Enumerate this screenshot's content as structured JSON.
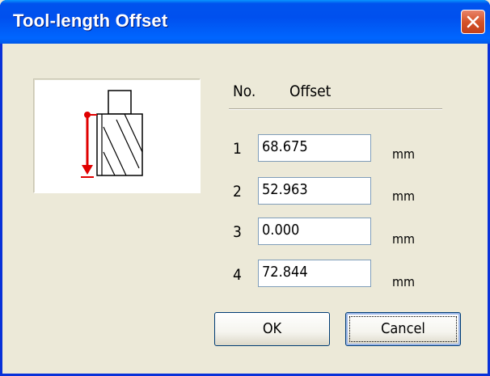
{
  "window": {
    "title": "Tool-length Offset"
  },
  "table": {
    "header_no": "No.",
    "header_offset": "Offset",
    "rows": [
      {
        "no": "1",
        "value": "68.675",
        "unit": "mm"
      },
      {
        "no": "2",
        "value": "52.963",
        "unit": "mm"
      },
      {
        "no": "3",
        "value": "0.000",
        "unit": "mm"
      },
      {
        "no": "4",
        "value": "72.844",
        "unit": "mm"
      }
    ]
  },
  "buttons": {
    "ok": "OK",
    "cancel": "Cancel"
  },
  "colors": {
    "titlebar": "#0054e3",
    "dialog_bg": "#ece9d8",
    "close_button": "#d45329",
    "indicator_red": "#e00000"
  },
  "icons": {
    "close": "close-icon",
    "tool_diagram": "tool-length-diagram-icon"
  }
}
